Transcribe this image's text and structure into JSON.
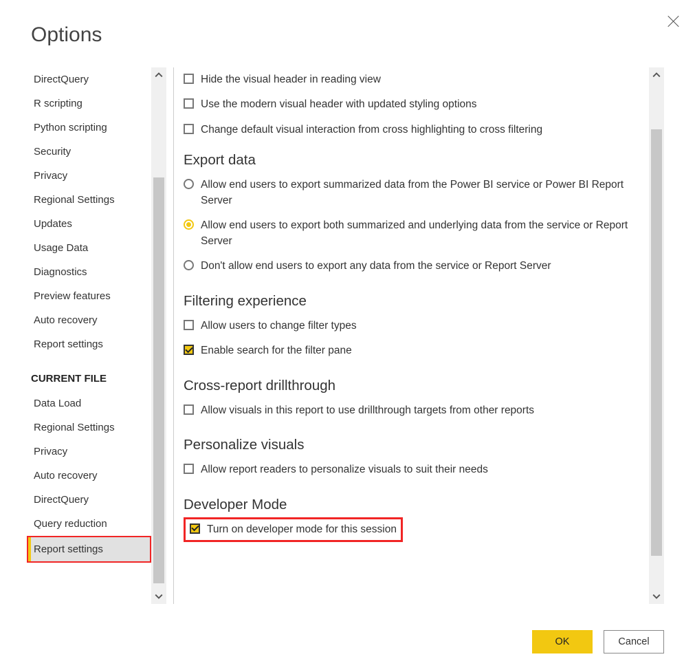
{
  "window": {
    "title": "Options"
  },
  "sidebar": {
    "global_items": [
      "DirectQuery",
      "R scripting",
      "Python scripting",
      "Security",
      "Privacy",
      "Regional Settings",
      "Updates",
      "Usage Data",
      "Diagnostics",
      "Preview features",
      "Auto recovery",
      "Report settings"
    ],
    "section_header": "CURRENT FILE",
    "current_file_items": [
      "Data Load",
      "Regional Settings",
      "Privacy",
      "Auto recovery",
      "DirectQuery",
      "Query reduction",
      "Report settings"
    ],
    "selected": "Report settings"
  },
  "content": {
    "top_checks": [
      {
        "checked": false,
        "label": "Hide the visual header in reading view"
      },
      {
        "checked": false,
        "label": "Use the modern visual header with updated styling options"
      },
      {
        "checked": false,
        "label": "Change default visual interaction from cross highlighting to cross filtering"
      }
    ],
    "export_header": "Export data",
    "export_radios": [
      {
        "selected": false,
        "label": "Allow end users to export summarized data from the Power BI service or Power BI Report Server"
      },
      {
        "selected": true,
        "label": "Allow end users to export both summarized and underlying data from the service or Report Server"
      },
      {
        "selected": false,
        "label": "Don't allow end users to export any data from the service or Report Server"
      }
    ],
    "filtering_header": "Filtering experience",
    "filtering_checks": [
      {
        "checked": false,
        "label": "Allow users to change filter types"
      },
      {
        "checked": true,
        "label": "Enable search for the filter pane"
      }
    ],
    "cross_header": "Cross-report drillthrough",
    "cross_check": {
      "checked": false,
      "label": "Allow visuals in this report to use drillthrough targets from other reports"
    },
    "personalize_header": "Personalize visuals",
    "personalize_check": {
      "checked": false,
      "label": "Allow report readers to personalize visuals to suit their needs"
    },
    "developer_header": "Developer Mode",
    "developer_check": {
      "checked": true,
      "label": "Turn on developer mode for this session"
    }
  },
  "footer": {
    "ok": "OK",
    "cancel": "Cancel"
  },
  "colors": {
    "accent": "#f2c811",
    "highlight_border": "#f12525"
  }
}
